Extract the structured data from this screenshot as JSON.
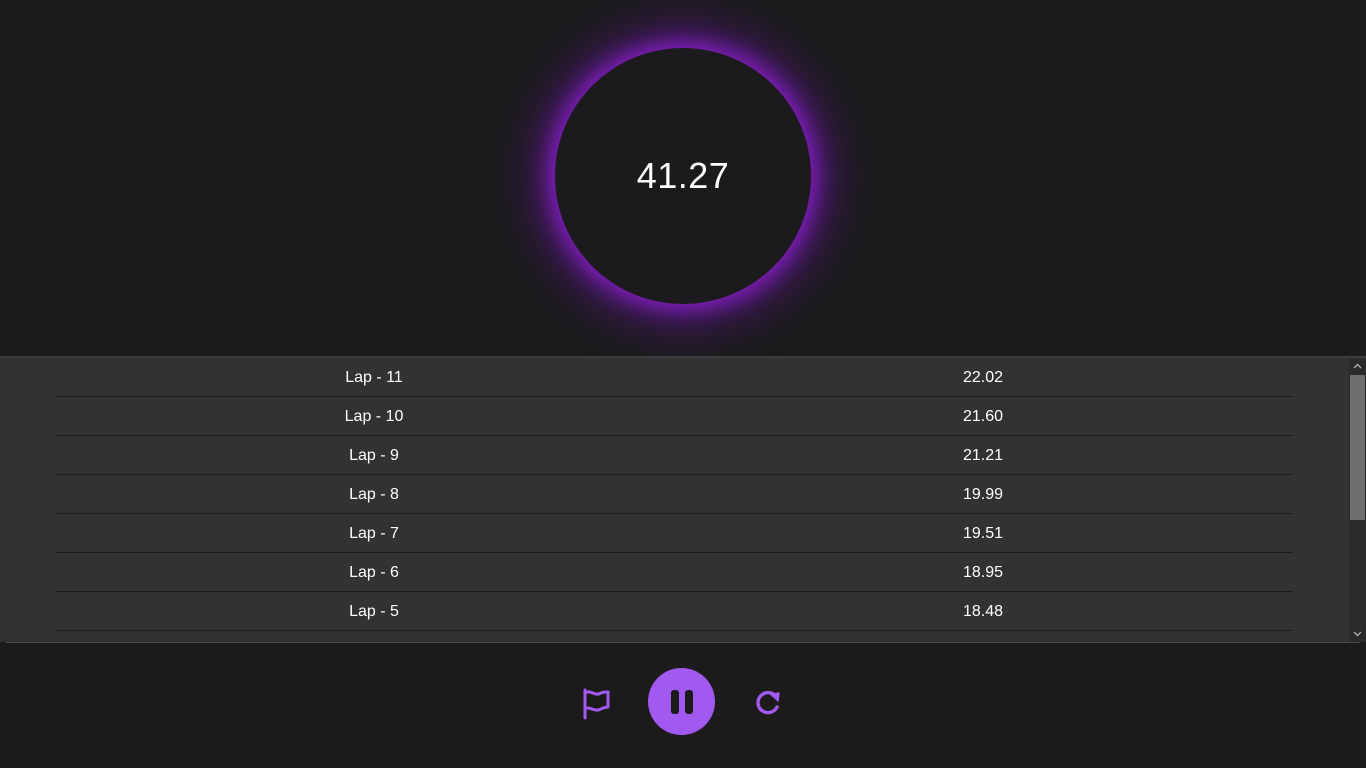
{
  "timer": {
    "value": "41.27"
  },
  "laps": [
    {
      "name": "Lap - 11",
      "time": "22.02"
    },
    {
      "name": "Lap - 10",
      "time": "21.60"
    },
    {
      "name": "Lap - 9",
      "time": "21.21"
    },
    {
      "name": "Lap - 8",
      "time": "19.99"
    },
    {
      "name": "Lap - 7",
      "time": "19.51"
    },
    {
      "name": "Lap - 6",
      "time": "18.95"
    },
    {
      "name": "Lap - 5",
      "time": "18.48"
    }
  ],
  "controls": {
    "lap_icon": "flag-icon",
    "main_icon": "pause-icon",
    "reset_icon": "reset-icon"
  },
  "colors": {
    "accent": "#a259f0",
    "glow": "#8a2bd0",
    "background": "#1b1b1c",
    "panel": "#323232"
  }
}
